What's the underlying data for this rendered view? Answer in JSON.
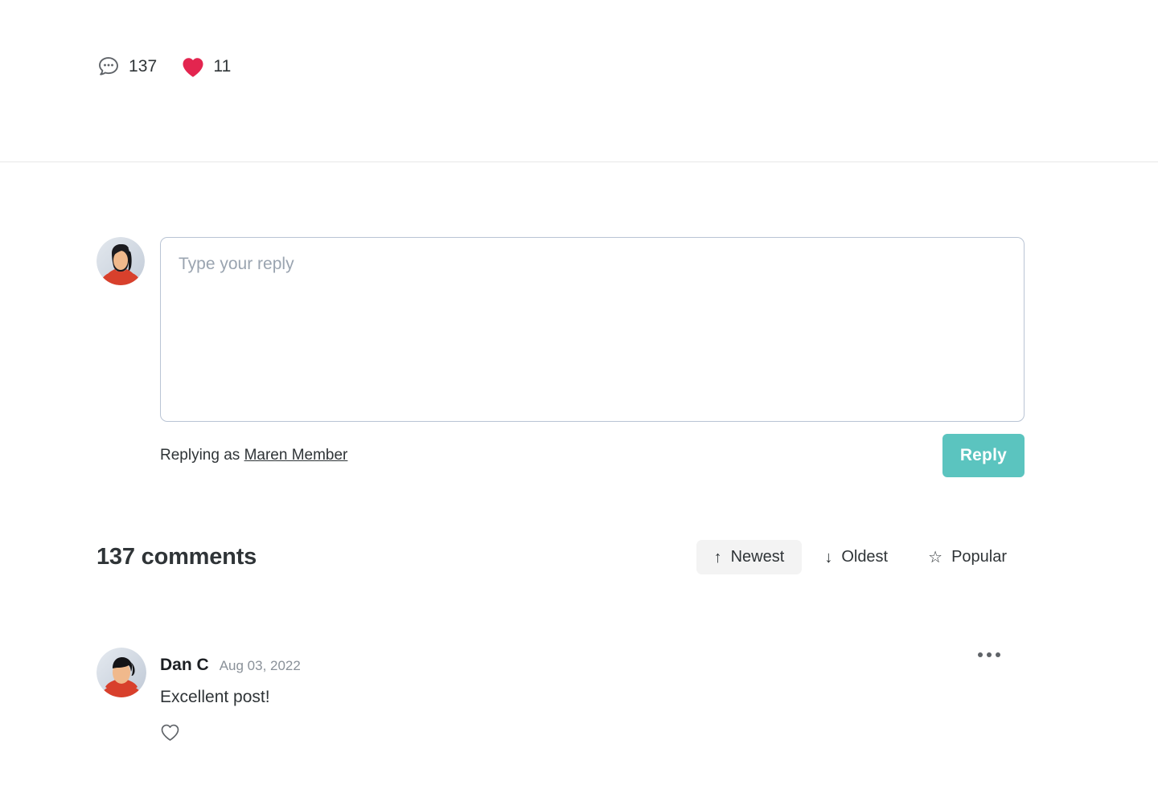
{
  "post_stats": {
    "comment_icon": "comment-bubble-icon",
    "comment_count": "137",
    "like_icon": "heart-filled-icon",
    "like_count": "11"
  },
  "composer": {
    "avatar_icon": "user-avatar-female",
    "placeholder": "Type your reply",
    "value": "",
    "replying_prefix": "Replying as",
    "user_name": "Maren Member",
    "reply_label": "Reply",
    "reply_button_color": "#5bc4bf"
  },
  "comments_section": {
    "title": "137 comments",
    "sort_options": [
      {
        "label": "Newest",
        "glyph": "↑",
        "icon": "arrow-up-icon",
        "active": true
      },
      {
        "label": "Oldest",
        "glyph": "↓",
        "icon": "arrow-down-icon",
        "active": false
      },
      {
        "label": "Popular",
        "glyph": "☆",
        "icon": "star-outline-icon",
        "active": false
      }
    ],
    "comments": [
      {
        "avatar_icon": "user-avatar-male",
        "author": "Dan C",
        "date": "Aug 03, 2022",
        "text": "Excellent post!",
        "like_icon": "heart-outline-icon",
        "more_icon": "more-horizontal-icon"
      }
    ]
  },
  "colors": {
    "accent_teal": "#5bc4bf",
    "heart_red": "#e3254f",
    "text_primary": "#2f3437",
    "text_muted": "#8a9199",
    "border": "#b9c4d4",
    "divider": "#e8e8e8"
  }
}
